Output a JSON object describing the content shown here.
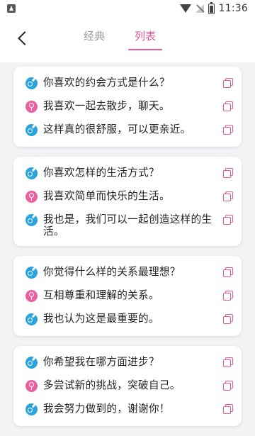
{
  "status_bar": {
    "time": "11:36"
  },
  "header": {
    "tabs": [
      "经典",
      "列表"
    ],
    "active_tab": "列表"
  },
  "accent_color": "#e9579a",
  "male_color": "#2aa4df",
  "female_color": "#ec5fa0",
  "conversations": [
    {
      "lines": [
        {
          "speaker": "male",
          "text": "你喜欢的约会方式是什么？"
        },
        {
          "speaker": "female",
          "text": "我喜欢一起去散步，聊天。"
        },
        {
          "speaker": "male",
          "text": "这样真的很舒服，可以更亲近。"
        }
      ]
    },
    {
      "lines": [
        {
          "speaker": "male",
          "text": "你喜欢怎样的生活方式？"
        },
        {
          "speaker": "female",
          "text": "我喜欢简单而快乐的生活。"
        },
        {
          "speaker": "male",
          "text": "我也是，我们可以一起创造这样的生活。"
        }
      ]
    },
    {
      "lines": [
        {
          "speaker": "male",
          "text": "你觉得什么样的关系最理想？"
        },
        {
          "speaker": "female",
          "text": "互相尊重和理解的关系。"
        },
        {
          "speaker": "male",
          "text": "我也认为这是最重要的。"
        }
      ]
    },
    {
      "lines": [
        {
          "speaker": "male",
          "text": "你希望我在哪方面进步？"
        },
        {
          "speaker": "female",
          "text": "多尝试新的挑战，突破自己。"
        },
        {
          "speaker": "male",
          "text": "我会努力做到的，谢谢你！"
        }
      ]
    }
  ]
}
